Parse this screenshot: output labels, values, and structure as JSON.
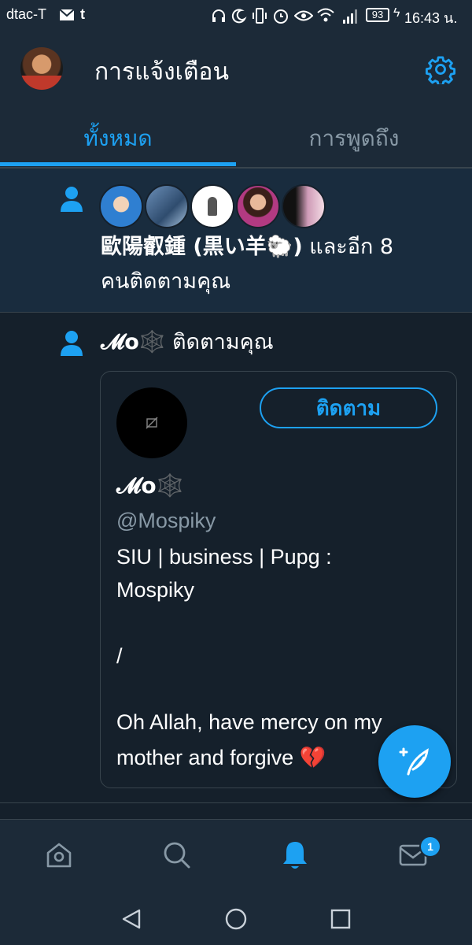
{
  "status_bar": {
    "carrier": "dtac-T",
    "battery": "93",
    "time": "16:43 น."
  },
  "header": {
    "title": "การแจ้งเตือน"
  },
  "tabs": [
    {
      "label": "ทั้งหมด",
      "active": true
    },
    {
      "label": "การพูดถึง",
      "active": false
    }
  ],
  "notifications": [
    {
      "type": "follow",
      "line1_name": "歐陽叡鍾 (黒い羊🐑)",
      "line1_rest": " และอีก 8",
      "line2": "คนติดตามคุณ"
    },
    {
      "type": "follow",
      "name": "𝓜o🕸️",
      "action": "ติดตามคุณ",
      "card": {
        "follow_label": "ติดตาม",
        "display_name": "𝓜o🕸️",
        "handle": "@Mospiky",
        "bio_lines": [
          "SIU |  business  |  Pupg :",
          "Mospiky",
          "",
          "/",
          "",
          "Oh Allah, have mercy on my",
          "mother and forgive  💔"
        ]
      }
    }
  ],
  "bottom_nav": {
    "messages_badge": "1"
  },
  "colors": {
    "accent": "#1da1f2",
    "background": "#15202b",
    "header_bg": "#1c2a38",
    "unread_bg": "#192c3e",
    "muted_text": "#8899a6"
  }
}
